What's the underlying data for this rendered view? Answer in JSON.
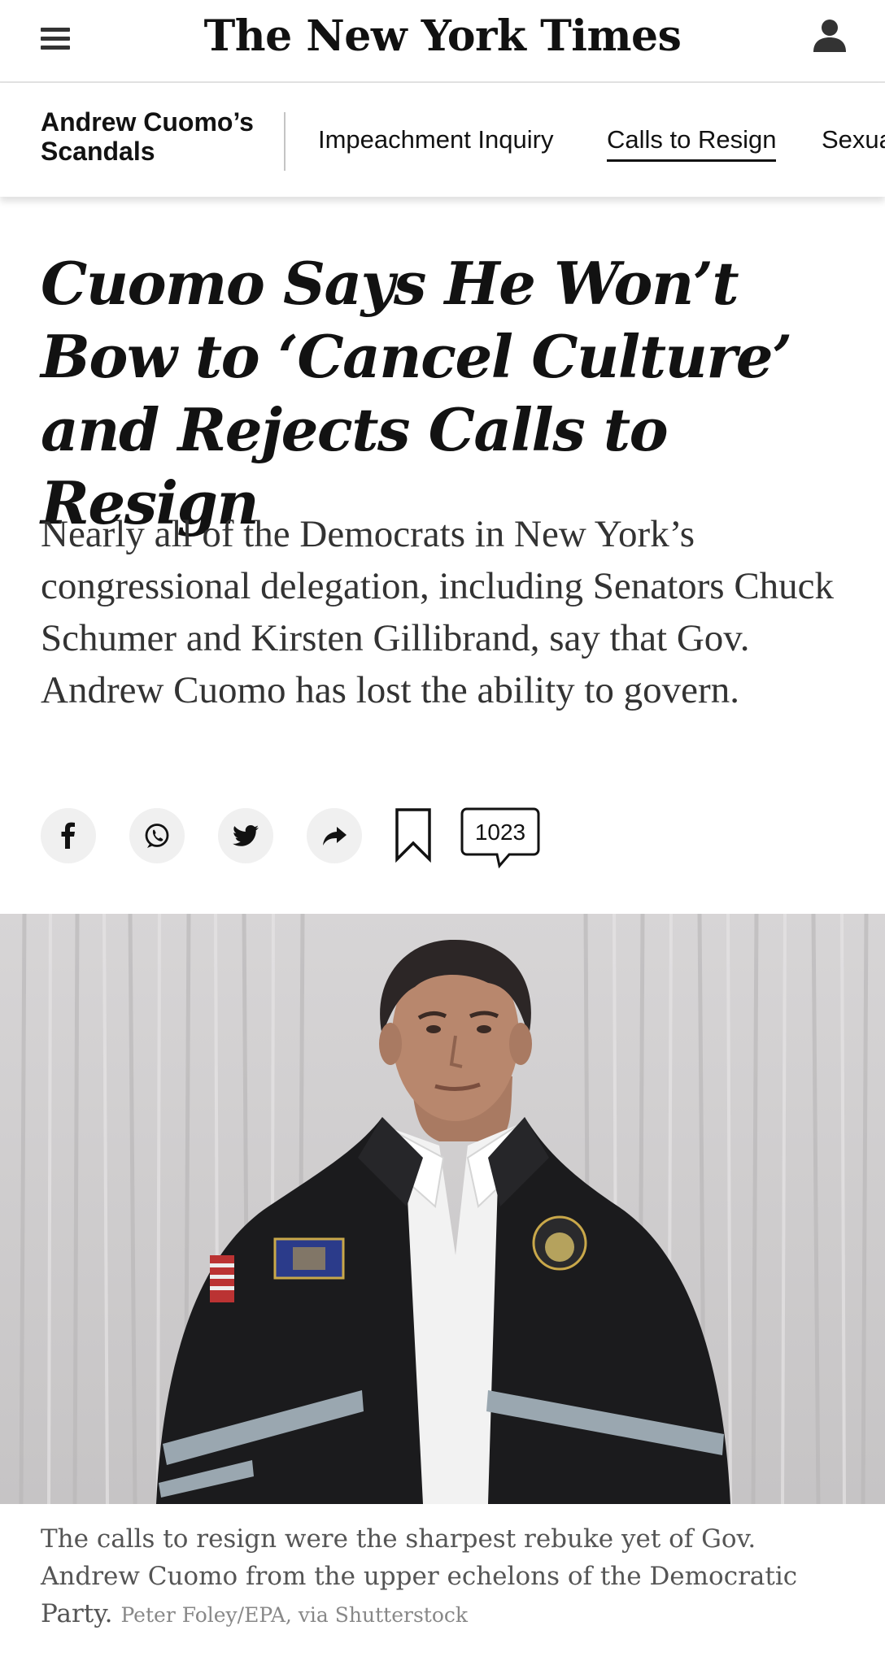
{
  "header": {
    "logo_text": "The New York Times",
    "menu_icon": "hamburger-menu-icon",
    "account_icon": "person-account-icon"
  },
  "subnav": {
    "section_title": "Andrew Cuomo’s Scandals",
    "links": [
      {
        "label": "Impeachment Inquiry",
        "active": false
      },
      {
        "label": "Calls to Resign",
        "active": true
      },
      {
        "label": "Sexua",
        "active": false
      }
    ]
  },
  "article": {
    "headline": "Cuomo Says He Won’t Bow to ‘Cancel Culture’ and Rejects Calls to Resign",
    "summary": "Nearly all of the Democrats in New York’s congressional delegation, including Senators Chuck Schumer and Kirsten Gillibrand, say that Gov. Andrew Cuomo has lost the ability to govern."
  },
  "share": {
    "buttons": [
      {
        "icon": "facebook-icon"
      },
      {
        "icon": "whatsapp-icon"
      },
      {
        "icon": "twitter-icon"
      },
      {
        "icon": "share-arrow-icon"
      }
    ],
    "bookmark_icon": "bookmark-icon",
    "comment_icon": "comment-bubble-icon",
    "comment_count": "1023"
  },
  "photo": {
    "caption": "The calls to resign were the sharpest rebuke yet of Gov. Andrew Cuomo from the upper echelons of the Democratic Party.",
    "credit": "Peter Foley/EPA, via Shutterstock"
  },
  "colors": {
    "text": "#121212",
    "summary_text": "#333333",
    "caption_text": "#555555",
    "button_bg": "#f0f0f0"
  }
}
